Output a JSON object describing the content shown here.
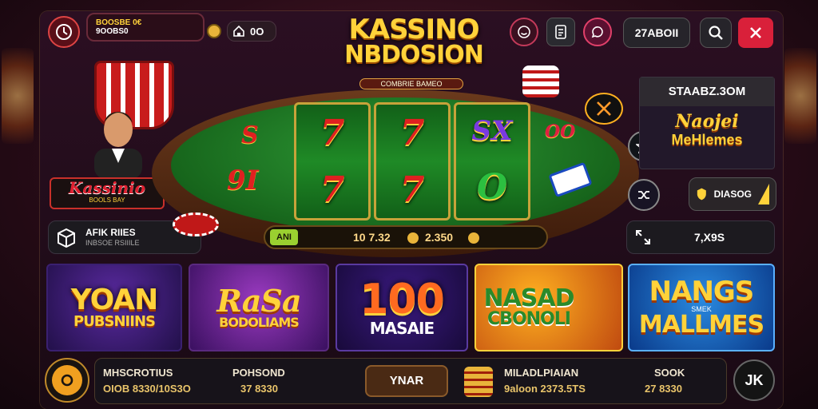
{
  "header": {
    "balance_label": "BOOSBE 0€",
    "balance_value": "9OOBS0",
    "home_value": "0O",
    "counter": "27ABOII"
  },
  "logo": {
    "line1": "KASSINO",
    "line2": "NBDOSION",
    "sub": "COMBRIE BAMEO"
  },
  "left": {
    "badge_title": "Kassinio",
    "badge_sub": "BOOLS BAY",
    "info_label1": "AFIK RIIES",
    "info_label2": "INBSOE RSIIILE"
  },
  "table": {
    "reel_symbols": [
      "7",
      "7",
      "SX",
      "7",
      "7",
      "O"
    ],
    "felt_symbols": [
      "S",
      "9I",
      "OO"
    ],
    "bet_tag": "ANI",
    "bet_value": "10 7.32",
    "win_value": "2.350"
  },
  "right": {
    "panel_title": "STAABZ.3OM",
    "promo_line1": "Naojei",
    "promo_line2": "MeHlemes",
    "bonus_value": "DIASOG",
    "stat_value": "7,X9S"
  },
  "cards": [
    {
      "line1": "YOAN",
      "line2": "PUBSNIINS"
    },
    {
      "line1": "RaSa",
      "line2": "BODOLIAMS"
    },
    {
      "line1": "100",
      "line2": "MASAIE"
    },
    {
      "line1": "NASAD",
      "line2": "CBONOLI"
    },
    {
      "line1": "NANGS",
      "line2": "MALLMES",
      "tag": "SMEK"
    }
  ],
  "bottom": {
    "label1": "MHSCROTIUS",
    "value1": "OIOB 8330/10S3O",
    "label2": "POHSOND",
    "value2": "37 8330",
    "play_button": "YNAR",
    "label3": "MILADLPIAIAN",
    "value3": "9aloon 2373.5TS",
    "label4": "SOOK",
    "value4": "27 8330",
    "close_label": "JK"
  },
  "colors": {
    "gold": "#ffd23a",
    "felt": "#1f8a26",
    "accent_red": "#e0203a"
  }
}
